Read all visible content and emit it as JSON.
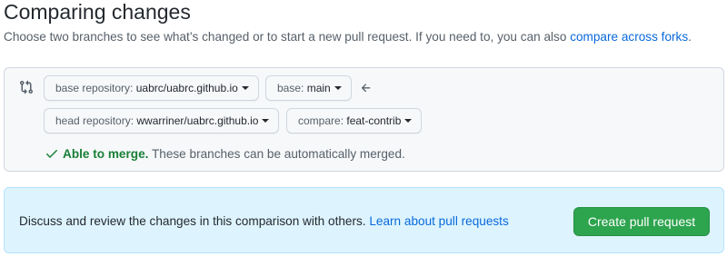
{
  "header": {
    "title": "Comparing changes",
    "subtitle_text": "Choose two branches to see what’s changed or to start a new pull request. If you need to, you can also ",
    "subtitle_link": "compare across forks",
    "subtitle_end": "."
  },
  "range": {
    "base_repo": {
      "label": "base repository: ",
      "value": "uabrc/uabrc.github.io"
    },
    "base_branch": {
      "label": "base: ",
      "value": "main"
    },
    "head_repo": {
      "label": "head repository: ",
      "value": "wwarriner/uabrc.github.io"
    },
    "compare_branch": {
      "label": "compare: ",
      "value": "feat-contrib"
    },
    "merge_status": {
      "ok_label": "Able to merge.",
      "detail": " These branches can be automatically merged."
    },
    "icons": [
      "git-compare-icon",
      "arrow-left-icon",
      "check-icon"
    ]
  },
  "pull_request": {
    "text": "Discuss and review the changes in this comparison with others. ",
    "link": "Learn about pull requests",
    "button_label": "Create pull request"
  },
  "colors": {
    "link": "#0969da",
    "success": "#1a7f37",
    "primary_button": "#2da44e",
    "info_background": "#ddf4ff"
  }
}
